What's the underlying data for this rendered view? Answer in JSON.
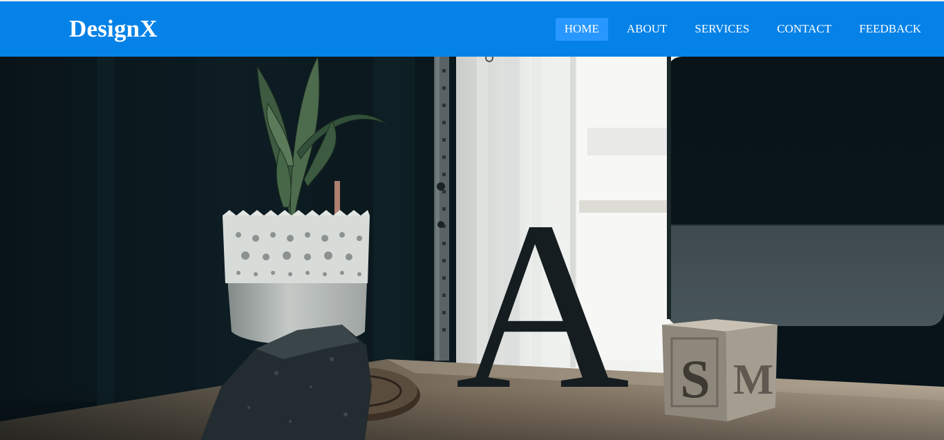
{
  "brand": {
    "name": "DesignX"
  },
  "nav": {
    "items": [
      {
        "label": "HOME",
        "active": true
      },
      {
        "label": "ABOUT",
        "active": false
      },
      {
        "label": "SERVICES",
        "active": false
      },
      {
        "label": "CONTACT",
        "active": false
      },
      {
        "label": "FEEDBACK",
        "active": false
      }
    ]
  },
  "hero": {
    "letter_a": "A",
    "block_letter_s": "S",
    "block_letter_m": "M"
  },
  "colors": {
    "navbar_bg": "#0582e8",
    "nav_active_bg": "#2897ff",
    "nav_text": "#ffffff"
  }
}
